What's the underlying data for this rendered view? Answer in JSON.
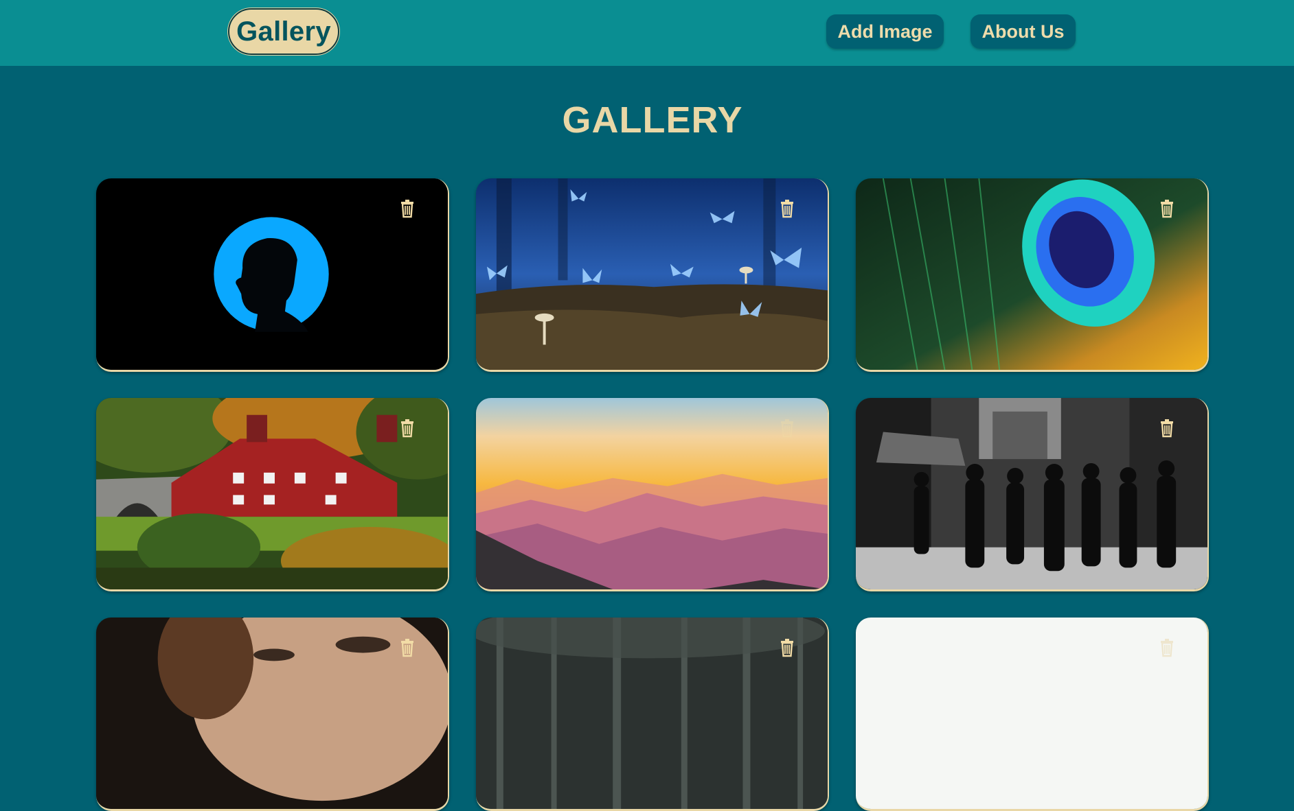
{
  "nav": {
    "brand": "Gallery",
    "add_image": "Add Image",
    "about_us": "About Us"
  },
  "page": {
    "title": "GALLERY"
  },
  "gallery": {
    "images": [
      {
        "subject": "silhouette profile in blue circle"
      },
      {
        "subject": "blue butterflies and mushrooms in forest"
      },
      {
        "subject": "peacock feather close-up"
      },
      {
        "subject": "ivy-covered cottage with stone bridge"
      },
      {
        "subject": "sunset over mountain ranges"
      },
      {
        "subject": "black and white city street crowd"
      },
      {
        "subject": "woman portrait close-up"
      },
      {
        "subject": "dark forest"
      },
      {
        "subject": "blank white image"
      }
    ],
    "delete_icon": "trash-icon"
  },
  "colors": {
    "navbar": "#0a8e92",
    "background": "#016172",
    "accent": "#e9d7a6",
    "button": "#016172"
  }
}
